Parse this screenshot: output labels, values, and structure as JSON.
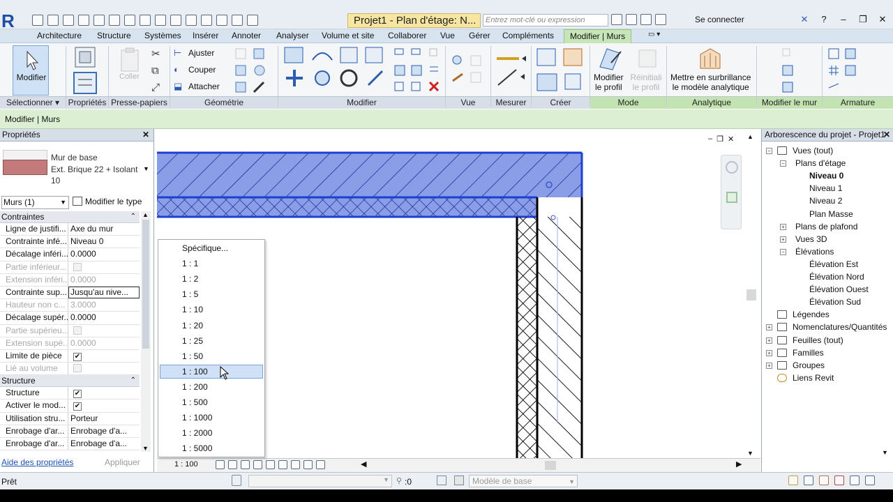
{
  "app": {
    "logo": "R",
    "document_title": "Projet1 - Plan d'étage: N...",
    "search_placeholder": "Entrez mot-clé ou expression",
    "sign_in": "Se connecter",
    "accent": "#1d4fa5"
  },
  "tabs": [
    {
      "label": "Architecture"
    },
    {
      "label": "Structure"
    },
    {
      "label": "Systèmes"
    },
    {
      "label": "Insérer"
    },
    {
      "label": "Annoter"
    },
    {
      "label": "Analyser"
    },
    {
      "label": "Volume et site"
    },
    {
      "label": "Collaborer"
    },
    {
      "label": "Vue"
    },
    {
      "label": "Gérer"
    },
    {
      "label": "Compléments"
    },
    {
      "label": "Modifier | Murs",
      "active": true
    }
  ],
  "ribbon": {
    "modifier": "Modifier",
    "coller": "Coller",
    "ajuster": "Ajuster",
    "couper": "Couper",
    "attacher": "Attacher",
    "modifier_profil": "Modifier\nle profil",
    "reinit_profil": "Réinitiali\nle profil",
    "surbrillance": "Mettre en surbrillance\nle modèle analytique",
    "panels": {
      "selectionner": "Sélectionner",
      "proprietes": "Propriétés",
      "presse_papiers": "Presse-papiers",
      "geometrie": "Géométrie",
      "modifier": "Modifier",
      "vue": "Vue",
      "mesurer": "Mesurer",
      "creer": "Créer",
      "mode": "Mode",
      "analytique": "Analytique",
      "modifier_le_mur": "Modifier le mur",
      "armature": "Armature"
    }
  },
  "options_bar": {
    "label": "Modifier | Murs"
  },
  "properties": {
    "title": "Propriétés",
    "type_family": "Mur de base",
    "type_name": "Ext. Brique 22 + Isolant 10",
    "instance_filter": "Murs (1)",
    "edit_type": "Modifier le type",
    "groups": [
      {
        "name": "Contraintes",
        "rows": [
          {
            "key": "Ligne de justifi...",
            "value": "Axe du mur"
          },
          {
            "key": "Contrainte infé...",
            "value": "Niveau 0"
          },
          {
            "key": "Décalage inféri...",
            "value": "0.0000"
          },
          {
            "key": "Partie inférieur...",
            "value": "",
            "checkbox": false,
            "disabled": true
          },
          {
            "key": "Extension inféri...",
            "value": "0.0000",
            "disabled": true
          },
          {
            "key": "Contrainte sup...",
            "value": "Jusqu'au nive...",
            "selected": true
          },
          {
            "key": "Hauteur non c...",
            "value": "3.0000",
            "disabled": true
          },
          {
            "key": "Décalage supér...",
            "value": "0.0000"
          },
          {
            "key": "Partie supérieu...",
            "value": "",
            "checkbox": false,
            "disabled": true
          },
          {
            "key": "Extension supé...",
            "value": "0.0000",
            "disabled": true
          },
          {
            "key": "Limite de pièce",
            "value": "",
            "checkbox": true
          },
          {
            "key": "Lié au volume",
            "value": "",
            "checkbox": false,
            "disabled": true
          }
        ]
      },
      {
        "name": "Structure",
        "rows": [
          {
            "key": "Structure",
            "value": "",
            "checkbox": true
          },
          {
            "key": "Activer le mod...",
            "value": "",
            "checkbox": true
          },
          {
            "key": "Utilisation stru...",
            "value": "Porteur"
          },
          {
            "key": "Enrobage d'ar...",
            "value": "Enrobage d'a..."
          },
          {
            "key": "Enrobage d'ar...",
            "value": "Enrobage d'a..."
          }
        ]
      }
    ],
    "help_link": "Aide des propriétés",
    "apply": "Appliquer"
  },
  "scale_menu": {
    "items": [
      "Spécifique...",
      "1 : 1",
      "1 : 2",
      "1 : 5",
      "1 : 10",
      "1 : 20",
      "1 : 25",
      "1 : 50",
      "1 : 100",
      "1 : 200",
      "1 : 500",
      "1 : 1000",
      "1 : 2000",
      "1 : 5000"
    ],
    "highlighted": "1 : 100",
    "current": "1 : 100"
  },
  "browser": {
    "title": "Arborescence du projet - Projet1",
    "nodes": [
      {
        "label": "Vues (tout)",
        "level": 0,
        "expander": "−",
        "icon": "views-icon"
      },
      {
        "label": "Plans d'étage",
        "level": 1,
        "expander": "−"
      },
      {
        "label": "Niveau 0",
        "level": 2,
        "bold": true
      },
      {
        "label": "Niveau 1",
        "level": 2
      },
      {
        "label": "Niveau 2",
        "level": 2
      },
      {
        "label": "Plan Masse",
        "level": 2
      },
      {
        "label": "Plans de plafond",
        "level": 1,
        "expander": "+"
      },
      {
        "label": "Vues 3D",
        "level": 1,
        "expander": "+"
      },
      {
        "label": "Élévations",
        "level": 1,
        "expander": "−"
      },
      {
        "label": "Élévation Est",
        "level": 2
      },
      {
        "label": "Élévation Nord",
        "level": 2
      },
      {
        "label": "Élévation Ouest",
        "level": 2
      },
      {
        "label": "Élévation Sud",
        "level": 2
      },
      {
        "label": "Légendes",
        "level": 0,
        "icon": "legend-icon"
      },
      {
        "label": "Nomenclatures/Quantités",
        "level": 0,
        "expander": "+",
        "icon": "schedule-icon"
      },
      {
        "label": "Feuilles (tout)",
        "level": 0,
        "expander": "+",
        "icon": "sheet-icon"
      },
      {
        "label": "Familles",
        "level": 0,
        "expander": "+",
        "icon": "family-icon"
      },
      {
        "label": "Groupes",
        "level": 0,
        "expander": "+",
        "icon": "group-icon"
      },
      {
        "label": "Liens Revit",
        "level": 0,
        "icon": "link-icon"
      }
    ]
  },
  "status": {
    "text": "Prêt",
    "selection_count": ":0",
    "model": "Modèle de base"
  },
  "colors": {
    "wall_selected": "#1f3fd0",
    "wall_fill": "#8a9ee8",
    "modify_tab": "#c7e6b8",
    "title_highlight": "#f6e6a2"
  }
}
